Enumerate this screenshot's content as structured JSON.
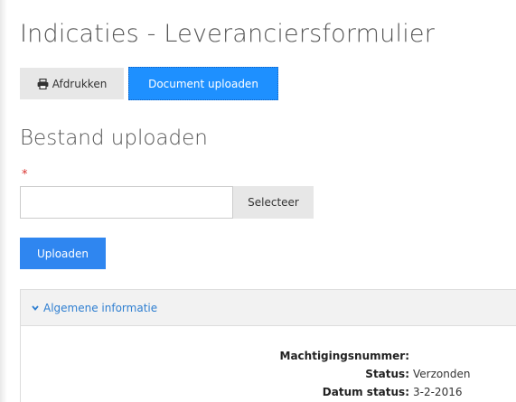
{
  "page": {
    "title": "Indicaties - Leveranciersformulier"
  },
  "toolbar": {
    "print_label": "Afdrukken",
    "upload_document_label": "Document uploaden"
  },
  "upload": {
    "section_title": "Bestand uploaden",
    "required_marker": "*",
    "file_value": "",
    "select_label": "Selecteer",
    "upload_label": "Uploaden"
  },
  "info": {
    "header_label": "Algemene informatie",
    "rows": [
      {
        "label": "Machtigingsnummer:",
        "value": ""
      },
      {
        "label": "Status:",
        "value": "Verzonden"
      },
      {
        "label": "Datum status:",
        "value": "3-2-2016"
      }
    ]
  },
  "colors": {
    "primary_button": "#1e90ff",
    "upload_button": "#2f86f0",
    "link": "#2f7fd1",
    "required": "#d9302c"
  },
  "icons": {
    "print": "printer-icon",
    "expand": "chevron-down-icon"
  }
}
